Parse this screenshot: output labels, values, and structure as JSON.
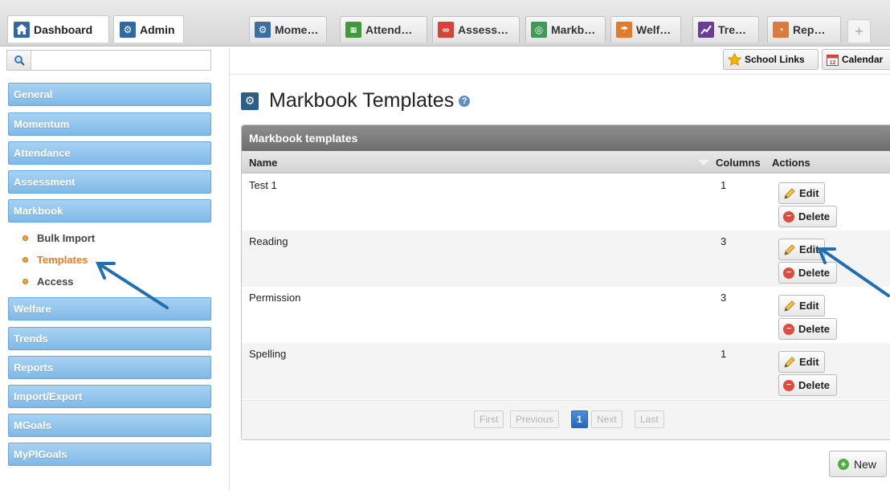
{
  "tabs": {
    "dashboard": "Dashboard",
    "admin": "Admin",
    "items": [
      {
        "label": "Mome…",
        "icon": "momentum-icon",
        "color": "#3a6fa6"
      },
      {
        "label": "Attend…",
        "icon": "attendance-icon",
        "color": "#3f9a3a"
      },
      {
        "label": "Assess…",
        "icon": "assessment-icon",
        "color": "#d7433a"
      },
      {
        "label": "Markb…",
        "icon": "markbook-icon",
        "color": "#3f9a5a"
      },
      {
        "label": "Welf…",
        "icon": "welfare-icon",
        "color": "#e07b2b"
      },
      {
        "label": "Tre…",
        "icon": "trends-icon",
        "color": "#6b3d99"
      },
      {
        "label": "Rep…",
        "icon": "reports-icon",
        "color": "#d97b3a"
      }
    ],
    "plus": "+"
  },
  "search": {
    "placeholder": "",
    "value": ""
  },
  "toolbar": {
    "school_links": "School Links",
    "calendar": "Calendar"
  },
  "sidebar": {
    "items": [
      "General",
      "Momentum",
      "Attendance",
      "Assessment",
      "Markbook",
      "Welfare",
      "Trends",
      "Reports",
      "Import/Export",
      "MGoals",
      "MyPIGoals"
    ],
    "sub_items": [
      "Bulk Import",
      "Templates",
      "Access"
    ],
    "active_sub": "Templates"
  },
  "page": {
    "title": "Markbook Templates",
    "help": "?"
  },
  "panel": {
    "header": "Markbook templates",
    "columns": {
      "name": "Name",
      "columns": "Columns",
      "actions": "Actions"
    },
    "rows": [
      {
        "name": "Test 1",
        "columns": "1"
      },
      {
        "name": "Reading",
        "columns": "3"
      },
      {
        "name": "Permission",
        "columns": "3"
      },
      {
        "name": "Spelling",
        "columns": "1"
      }
    ],
    "edit_label": "Edit",
    "delete_label": "Delete",
    "pager": {
      "first": "First",
      "previous": "Previous",
      "current": "1",
      "next": "Next",
      "last": "Last"
    }
  },
  "new_label": "New",
  "colors": {
    "accent": "#7fb9e8",
    "active": "#f07c1c",
    "annotation_arrow": "#1f6fb2"
  }
}
